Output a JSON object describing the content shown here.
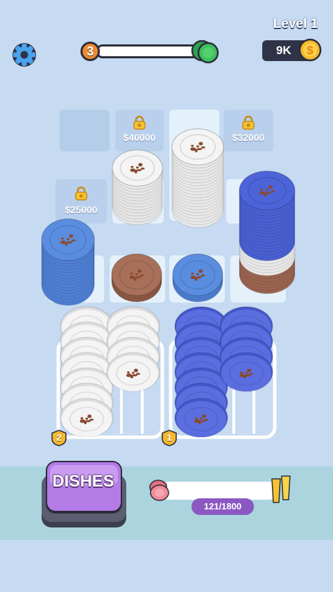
{
  "header": {
    "level_title": "Level 1",
    "current_level": "3",
    "money": "9K",
    "icons": {
      "settings": "gear-icon",
      "coin": "coin-icon",
      "reward": "green-plates-icon"
    }
  },
  "slots": [
    {
      "id": "slot-top-1",
      "state": "empty",
      "price": ""
    },
    {
      "id": "slot-top-2",
      "state": "locked",
      "price": "$40000"
    },
    {
      "id": "slot-top-3",
      "state": "open-with-stack",
      "price": ""
    },
    {
      "id": "slot-top-4",
      "state": "locked",
      "price": "$32000"
    },
    {
      "id": "slot-mid-1",
      "state": "locked",
      "price": "$25000"
    }
  ],
  "racks": [
    {
      "number": "2",
      "plate_color": "white"
    },
    {
      "number": "1",
      "plate_color": "blue"
    }
  ],
  "dishes_button": {
    "label": "DISHES"
  },
  "progress": {
    "count_label": "121/1800",
    "value": 121,
    "max": 1800
  },
  "colors": {
    "background": "#c6daf1",
    "plate_white": "#f4f4f4",
    "plate_blue": "#5a8de0",
    "plate_brown": "#a8705a",
    "plate_indigo": "#4d63d8",
    "button_purple": "#b27be6",
    "coin_gold": "#f5b82e"
  }
}
